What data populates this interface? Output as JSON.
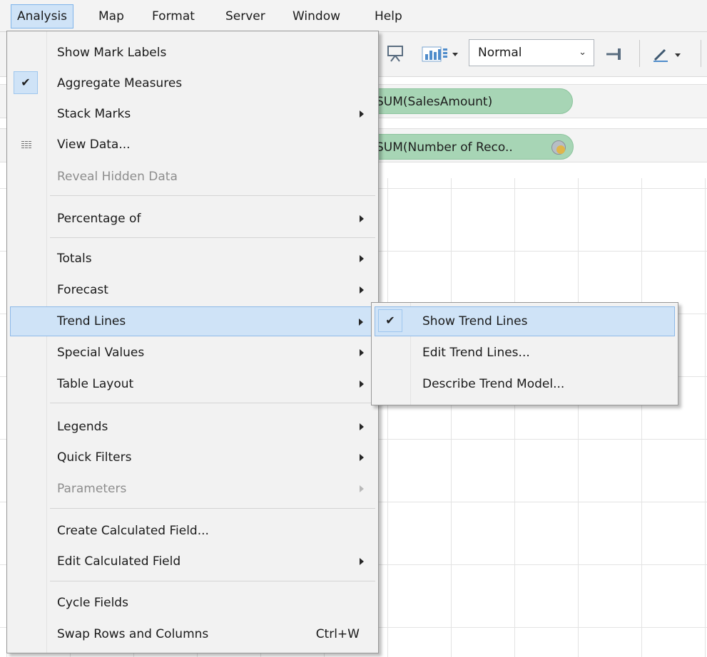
{
  "menubar": {
    "items": [
      "Analysis",
      "Map",
      "Format",
      "Server",
      "Window",
      "Help"
    ]
  },
  "toolbar": {
    "fit_select_value": "Normal"
  },
  "shelves": {
    "columns_pill": "SUM(SalesAmount)",
    "rows_pill": "SUM(Number of Reco.."
  },
  "analysis_menu": {
    "show_mark_labels": "Show Mark Labels",
    "aggregate_measures": "Aggregate Measures",
    "stack_marks": "Stack Marks",
    "view_data": "View Data...",
    "reveal_hidden_data": "Reveal Hidden Data",
    "percentage_of": "Percentage of",
    "totals": "Totals",
    "forecast": "Forecast",
    "trend_lines": "Trend Lines",
    "special_values": "Special Values",
    "table_layout": "Table Layout",
    "legends": "Legends",
    "quick_filters": "Quick Filters",
    "parameters": "Parameters",
    "create_calculated_field": "Create Calculated Field...",
    "edit_calculated_field": "Edit Calculated Field",
    "cycle_fields": "Cycle Fields",
    "swap_rows_and_columns": "Swap Rows and Columns",
    "swap_shortcut": "Ctrl+W",
    "checked_mark": "✔"
  },
  "trend_lines_submenu": {
    "show_trend_lines": "Show Trend Lines",
    "edit_trend_lines": "Edit Trend Lines...",
    "describe_trend_model": "Describe Trend Model...",
    "checked_mark": "✔"
  },
  "colors": {
    "highlight": "#cfe3f7",
    "highlight_border": "#8db9e8",
    "pill_green": "#a7d5b5",
    "menu_bg": "#f2f2f2"
  }
}
